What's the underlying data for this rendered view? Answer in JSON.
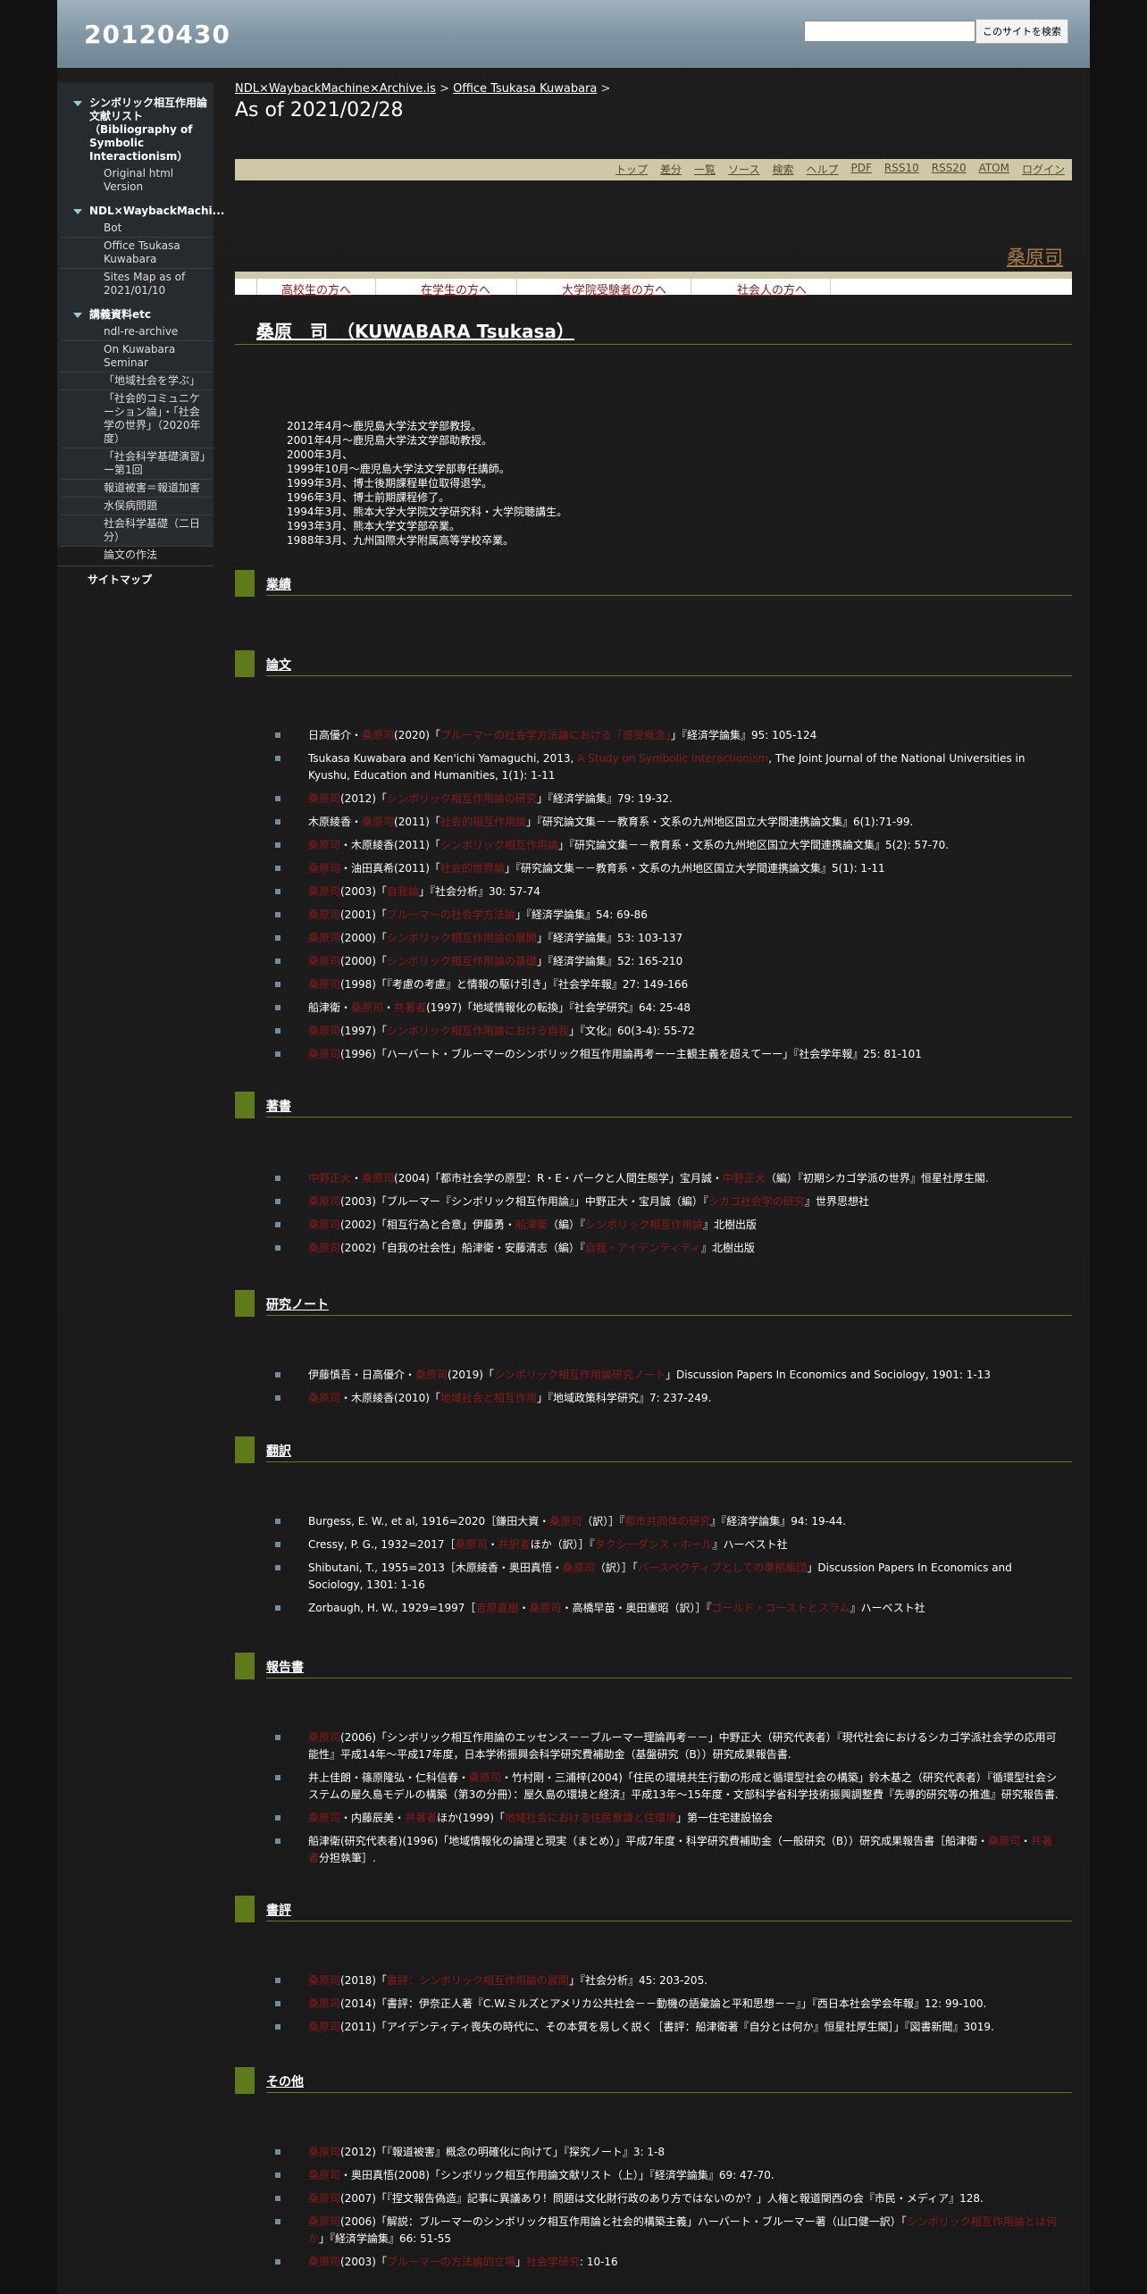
{
  "header": {
    "site_title": "20120430",
    "search_placeholder": "",
    "search_button": "このサイトを検索"
  },
  "sidebar": {
    "groups": [
      {
        "title": "シンボリック相互作用論文献リスト（Bibliography of Symbolic Interactionism）",
        "items": [
          "Original html Version"
        ]
      },
      {
        "title": "NDL×WaybackMachi...",
        "items": [
          "Bot",
          "Office Tsukasa Kuwabara",
          "Sites Map as of 2021/01/10"
        ]
      },
      {
        "title": "講義資料etc",
        "items": [
          "ndl-re-archive",
          "On Kuwabara Seminar",
          "「地域社会を学ぶ」",
          "「社会的コミュニケーション論」・「社会学の世界」（2020年度）",
          "「社会科学基礎演習」ー第1回",
          "報道被害＝報道加害",
          "水俣病問題",
          "社会科学基礎（二日分）",
          "論文の作法"
        ]
      }
    ],
    "sitemap": "サイトマップ"
  },
  "main": {
    "breadcrumb": {
      "link1": "NDL×WaybackMachine×Archive.is",
      "sep": ">",
      "link2": "Office Tsukasa Kuwabara",
      "sep2": ">"
    },
    "page_title": "As of 2021/02/28",
    "nav_links": [
      "トップ",
      "差分",
      "一覧",
      "ソース",
      "検索",
      "ヘルプ",
      "PDF",
      "RSS10",
      "RSS20",
      "ATOM",
      "ログイン"
    ],
    "author_link": "桑原司",
    "audience_links": [
      "高校生の方へ",
      "在学生の方へ",
      "大学院受験者の方へ",
      "社会人の方へ"
    ],
    "person_title": "桑原　司　（KUWABARA Tsukasa）",
    "top_label": "",
    "history_label": "",
    "history": [
      "2012年4月～鹿児島大学法文学部教授。",
      "2001年4月～鹿児島大学法文学部助教授。",
      "2000年3月、",
      "1999年10月～鹿児島大学法文学部専任講師。",
      "1999年3月、博士後期課程単位取得退学。",
      "1996年3月、博士前期課程修了。",
      "1994年3月、熊本大学大学院文学研究科・大学院聴講生。",
      "1993年3月、熊本大学文学部卒業。",
      "1988年3月、九州国際大学附属高等学校卒業。"
    ],
    "sections": {
      "gyoseki": "業績",
      "ronbun": "論文",
      "chosho": "著書",
      "note": "研究ノート",
      "honyaku": "翻訳",
      "hokoku": "報告書",
      "shohyo": "書評",
      "sonota": "その他"
    },
    "ronbun_items": [
      [
        "日高優介・",
        "(2020)「",
        "」『経済学論集』95: 105-124"
      ],
      [
        "Tsukasa Kuwabara and Ken'ichi Yamaguchi, 2013, ",
        "",
        ", The Joint Journal of the National Universities in Kyushu, Education and Humanities, 1(1): 1-11"
      ],
      [
        "",
        "(2012)「",
        "」『経済学論集』79: 19-32."
      ],
      [
        "木原綾香・",
        "(2011)「",
        "」『研究論文集－－教育系・文系の九州地区国立大学間連携論文集』6(1):71-99."
      ],
      [
        "",
        "・木原綾香(2011)「",
        "」『研究論文集－－教育系・文系の九州地区国立大学間連携論文集』5(2): 57-70."
      ],
      [
        "",
        "・油田真希(2011)「",
        "」『研究論文集－－教育系・文系の九州地区国立大学間連携論文集』5(1): 1-11"
      ],
      [
        "",
        "(2003)「",
        "」『社会分析』30: 57-74"
      ],
      [
        "",
        "(2001)「",
        "」『経済学論集』54: 69-86"
      ],
      [
        "",
        "(2000)「",
        "」『経済学論集』53: 103-137"
      ],
      [
        "",
        "(2000)「",
        "」『経済学論集』52: 165-210"
      ],
      [
        "",
        "(1998)「『考慮の考慮』と情報の駆け引き」『社会学年報』27: 149-166",
        ""
      ],
      [
        "船津衛・",
        "・",
        "(1997)「地域情報化の転換」『社会学研究』64: 25-48"
      ],
      [
        "",
        "(1997)「",
        "」『文化』60(3-4): 55-72"
      ],
      [
        "",
        "(1996)「ハーバート・ブルーマーのシンボリック相互作用論再考ーー主観主義を超えてーー」『社会学年報』25: 81-101",
        ""
      ]
    ],
    "chosho_items": [
      [
        "",
        "・",
        "(2004)「都市社会学の原型：R・E・パークと人間生態学」宝月誠・",
        "（編）『初期シカゴ学派の世界』恒星社厚生閣."
      ],
      [
        "",
        "(2003)「ブルーマー『シンボリック相互作用論』」中野正大・宝月誠（編）『",
        "』世界思想社",
        ""
      ],
      [
        "",
        "(2002)「相互行為と合意」伊藤勇・",
        "（編）『",
        "』北樹出版"
      ],
      [
        "",
        "(2002)「自我の社会性」船津衛・安藤清志（編）『",
        "』北樹出版",
        ""
      ]
    ],
    "note_items": [
      [
        "伊藤慎吾・日高優介・",
        "(2019)「",
        "」Discussion Papers In Economics and Sociology, 1901: 1-13"
      ],
      [
        "",
        "・木原綾香(2010)「",
        "」『地域政策科学研究』7: 237-249."
      ]
    ],
    "honyaku_items": [
      [
        "Burgess, E. W., et al, 1916=2020［鎌田大資・",
        "（訳）］『",
        "』『経済学論集』94: 19-44."
      ],
      [
        "Cressy, P. G., 1932=2017［",
        "・",
        "ほか（訳）］『",
        "』ハーベスト社"
      ],
      [
        "Shibutani, T., 1955=2013［木原綾香・奥田真悟・",
        "（訳）］「",
        "」Discussion Papers In Economics and Sociology, 1301: 1-16"
      ],
      [
        "Zorbaugh, H. W., 1929=1997［",
        "・",
        "・高橋早苗・奥田憲昭（訳）］『",
        "』ハーベスト社"
      ]
    ],
    "hokoku_items": [
      [
        "",
        "(2006)「シンボリック相互作用論のエッセンス－－ブルーマー理論再考－－」中野正大（研究代表者）『現代社会におけるシカゴ学派社会学の応用可能性』平成14年～平成17年度，日本学術振興会科学研究費補助金（基盤研究（B））研究成果報告書."
      ],
      [
        "井上佳朗・篠原隆弘・仁科信春・",
        "・竹村剛・三浦梓(2004)「住民の環境共生行動の形成と循環型社会の構築」鈴木基之（研究代表者）『循環型社会システムの屋久島モデルの構築（第3の分冊）：屋久島の環境と経済』平成13年～15年度・文部科学省科学技術振興調整費『先導的研究等の推進』研究報告書."
      ],
      [
        "",
        "・内藤辰美・",
        "ほか(1999)「",
        "」第一住宅建設協会"
      ],
      [
        "船津衛(研究代表者)(1996)「地域情報化の論理と現実（まとめ）」平成7年度・科学研究費補助金（一般研究（B））研究成果報告書［船津衛・",
        "・",
        "分担執筆］."
      ]
    ],
    "shohyo_items": [
      [
        "",
        "(2018)「",
        "」『社会分析』45: 203-205."
      ],
      [
        "",
        "(2014)「書評：伊奈正人著『C.W.ミルズとアメリカ公共社会－－動機の語彙論と平和思想－－』」『西日本社会学会年報』12: 99-100.",
        ""
      ],
      [
        "",
        "(2011)「アイデンティティ喪失の時代に、その本質を易しく説く［書評：船津衛著『自分とは何か』恒星社厚生閣］」『図書新聞』3019.",
        ""
      ]
    ],
    "sonota_items": [
      [
        "",
        "(2012)「『報道被害』概念の明確化に向けて」『探究ノート』3: 1-8"
      ],
      [
        "",
        "・奥田真悟(2008)「シンボリック相互作用論文献リスト（上）」『経済学論集』69: 47-70."
      ],
      [
        "",
        "(2007)「『捏文報告偽造』記事に異議あり！問題は文化財行政のあり方ではないのか？」人権と報道関西の会『市民・メディア』128."
      ],
      [
        "",
        "(2006)「解説：ブルーマーのシンボリック相互作用論と社会的構築主義」ハーバート・ブルーマー著（山口健一訳）「",
        "」『経済学論集』66: 51-55"
      ],
      [
        "",
        "(2003)「",
        "」",
        ": 10-16"
      ]
    ]
  }
}
